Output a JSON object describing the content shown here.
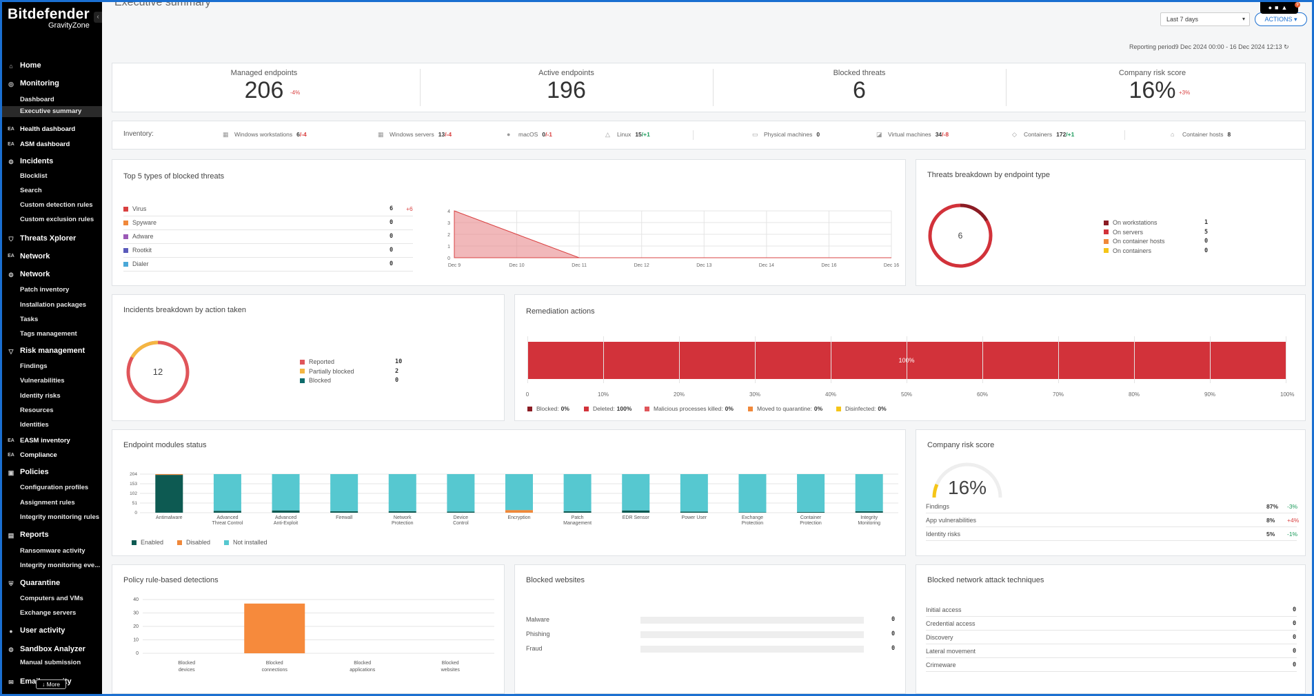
{
  "app": {
    "brand": "Bitdefender",
    "product": "GravityZone"
  },
  "page": {
    "title": "Executive summary"
  },
  "header": {
    "range": "Last 7 days",
    "actions": "ACTIONS",
    "badge": "9",
    "reporting_period": "Reporting period9 Dec 2024 00:00 - 16 Dec 2024 12:13"
  },
  "sidebar": {
    "items": [
      {
        "type": "s",
        "label": "Home",
        "icon": "⌂"
      },
      {
        "type": "s",
        "label": "Monitoring",
        "icon": "◎"
      },
      {
        "type": "i",
        "label": "Dashboard"
      },
      {
        "type": "i",
        "label": "Executive summary",
        "selected": true
      },
      {
        "type": "s",
        "label": "Health dashboard",
        "icon": "EA",
        "ea": true,
        "small": true
      },
      {
        "type": "s",
        "label": "ASM dashboard",
        "icon": "EA",
        "ea": true,
        "small": true
      },
      {
        "type": "s",
        "label": "Incidents",
        "icon": "⚙"
      },
      {
        "type": "i",
        "label": "Blocklist"
      },
      {
        "type": "i",
        "label": "Search"
      },
      {
        "type": "i",
        "label": "Custom detection rules"
      },
      {
        "type": "i",
        "label": "Custom exclusion rules"
      },
      {
        "type": "s",
        "label": "Threats Xplorer",
        "icon": "⛉"
      },
      {
        "type": "s",
        "label": "Network",
        "icon": "EA",
        "ea": true
      },
      {
        "type": "s",
        "label": "Network",
        "icon": "⚙"
      },
      {
        "type": "i",
        "label": "Patch inventory"
      },
      {
        "type": "i",
        "label": "Installation packages"
      },
      {
        "type": "i",
        "label": "Tasks"
      },
      {
        "type": "i",
        "label": "Tags management"
      },
      {
        "type": "s",
        "label": "Risk management",
        "icon": "▽"
      },
      {
        "type": "i",
        "label": "Findings"
      },
      {
        "type": "i",
        "label": "Vulnerabilities"
      },
      {
        "type": "i",
        "label": "Identity risks"
      },
      {
        "type": "i",
        "label": "Resources"
      },
      {
        "type": "i",
        "label": "Identities"
      },
      {
        "type": "s",
        "label": "EASM inventory",
        "icon": "EA",
        "ea": true,
        "small": true
      },
      {
        "type": "s",
        "label": "Compliance",
        "icon": "EA",
        "ea": true,
        "small": true
      },
      {
        "type": "s",
        "label": "Policies",
        "icon": "▣"
      },
      {
        "type": "i",
        "label": "Configuration profiles"
      },
      {
        "type": "i",
        "label": "Assignment rules"
      },
      {
        "type": "i",
        "label": "Integrity monitoring rules"
      },
      {
        "type": "s",
        "label": "Reports",
        "icon": "▤"
      },
      {
        "type": "i",
        "label": "Ransomware activity"
      },
      {
        "type": "i",
        "label": "Integrity monitoring eve..."
      },
      {
        "type": "s",
        "label": "Quarantine",
        "icon": "⛨"
      },
      {
        "type": "i",
        "label": "Computers and VMs"
      },
      {
        "type": "i",
        "label": "Exchange servers"
      },
      {
        "type": "s",
        "label": "User activity",
        "icon": "●"
      },
      {
        "type": "s",
        "label": "Sandbox Analyzer",
        "icon": "⚙"
      },
      {
        "type": "i",
        "label": "Manual submission"
      },
      {
        "type": "s",
        "label": "Email security",
        "icon": "✉"
      }
    ],
    "more": "↓ More"
  },
  "kpis": [
    {
      "label": "Managed endpoints",
      "value": "206",
      "delta": "-4%"
    },
    {
      "label": "Active endpoints",
      "value": "196",
      "delta": ""
    },
    {
      "label": "Blocked threats",
      "value": "6",
      "delta": ""
    },
    {
      "label": "Company risk score",
      "value": "16%",
      "delta": "+3%"
    }
  ],
  "inventory": {
    "label": "Inventory:",
    "items": [
      {
        "icon": "▦",
        "label": "Windows workstations",
        "value": "6",
        "delta": "/-4",
        "tone": "r"
      },
      {
        "icon": "▦",
        "label": "Windows servers",
        "value": "13",
        "delta": "/-4",
        "tone": "r"
      },
      {
        "icon": "●",
        "label": "macOS",
        "value": "0",
        "delta": "/-1",
        "tone": "r"
      },
      {
        "icon": "△",
        "label": "Linux",
        "value": "15",
        "delta": "/+1",
        "tone": "g"
      },
      {
        "icon": "▭",
        "label": "Physical machines",
        "value": "0",
        "delta": "",
        "tone": ""
      },
      {
        "icon": "◪",
        "label": "Virtual machines",
        "value": "34",
        "delta": "/-8",
        "tone": "r"
      },
      {
        "icon": "◇",
        "label": "Containers",
        "value": "172",
        "delta": "/+1",
        "tone": "g"
      },
      {
        "icon": "⌂",
        "label": "Container hosts",
        "value": "8",
        "delta": "",
        "tone": ""
      }
    ]
  },
  "top5": {
    "title": "Top 5 types of blocked threats",
    "items": [
      {
        "label": "Virus",
        "value": "6",
        "delta": "+6",
        "color": "#d94040"
      },
      {
        "label": "Spyware",
        "value": "0",
        "delta": "",
        "color": "#f0883a"
      },
      {
        "label": "Adware",
        "value": "0",
        "delta": "",
        "color": "#9b59b6"
      },
      {
        "label": "Rootkit",
        "value": "0",
        "delta": "",
        "color": "#5b5bbb"
      },
      {
        "label": "Dialer",
        "value": "0",
        "delta": "",
        "color": "#4aa8d8"
      }
    ]
  },
  "threats_breakdown": {
    "title": "Threats breakdown by endpoint type",
    "total": "6",
    "items": [
      {
        "label": "On workstations",
        "value": "1",
        "color": "#8b1c24"
      },
      {
        "label": "On servers",
        "value": "5",
        "color": "#d2323a"
      },
      {
        "label": "On container hosts",
        "value": "0",
        "color": "#f0883a"
      },
      {
        "label": "On containers",
        "value": "0",
        "color": "#f5c518"
      }
    ]
  },
  "incidents": {
    "title": "Incidents breakdown by action taken",
    "total": "12",
    "items": [
      {
        "label": "Reported",
        "value": "10",
        "color": "#e0555a"
      },
      {
        "label": "Partially blocked",
        "value": "2",
        "color": "#f4b642"
      },
      {
        "label": "Blocked",
        "value": "0",
        "color": "#0d6b6b"
      }
    ]
  },
  "remediation": {
    "title": "Remediation actions",
    "bar_label": "100%",
    "ticks": [
      "0",
      "10%",
      "20%",
      "30%",
      "40%",
      "50%",
      "60%",
      "70%",
      "80%",
      "90%",
      "100%"
    ],
    "legend": [
      {
        "label": "Blocked:",
        "value": "0%",
        "color": "#8b1c24"
      },
      {
        "label": "Deleted:",
        "value": "100%",
        "color": "#d2323a"
      },
      {
        "label": "Malicious processes killed:",
        "value": "0%",
        "color": "#e0555a"
      },
      {
        "label": "Moved to quarantine:",
        "value": "0%",
        "color": "#f0883a"
      },
      {
        "label": "Disinfected:",
        "value": "0%",
        "color": "#f5c518"
      }
    ]
  },
  "modules": {
    "title": "Endpoint modules status",
    "legend": [
      {
        "label": "Enabled",
        "color": "#0d5a52"
      },
      {
        "label": "Disabled",
        "color": "#f0883a"
      },
      {
        "label": "Not installed",
        "color": "#56c8d0"
      }
    ]
  },
  "risk": {
    "title": "Company risk score",
    "value": "16%",
    "rows": [
      {
        "label": "Findings",
        "value": "87%",
        "delta": "-3%",
        "tone": "g"
      },
      {
        "label": "App vulnerabilities",
        "value": "8%",
        "delta": "+4%",
        "tone": "r"
      },
      {
        "label": "Identity risks",
        "value": "5%",
        "delta": "-1%",
        "tone": "g"
      }
    ]
  },
  "policy": {
    "title": "Policy rule-based detections"
  },
  "blocked_websites": {
    "title": "Blocked websites",
    "rows": [
      {
        "label": "Malware",
        "value": "0"
      },
      {
        "label": "Phishing",
        "value": "0"
      },
      {
        "label": "Fraud",
        "value": "0"
      }
    ]
  },
  "network_attacks": {
    "title": "Blocked network attack techniques",
    "rows": [
      {
        "label": "Initial access",
        "value": "0"
      },
      {
        "label": "Credential access",
        "value": "0"
      },
      {
        "label": "Discovery",
        "value": "0"
      },
      {
        "label": "Lateral movement",
        "value": "0"
      },
      {
        "label": "Crimeware",
        "value": "0"
      }
    ]
  },
  "chart_data": [
    {
      "type": "area",
      "title": "Top 5 types of blocked threats",
      "x": [
        "Dec 9",
        "Dec 10",
        "Dec 11",
        "Dec 12",
        "Dec 13",
        "Dec 14",
        "Dec 16",
        "Dec 16"
      ],
      "series": [
        {
          "name": "Virus",
          "values": [
            4,
            2,
            0,
            0,
            0,
            0,
            0,
            0
          ]
        }
      ],
      "yticks": [
        "0",
        "1",
        "2",
        "3",
        "4"
      ],
      "ylim": [
        0,
        4
      ],
      "color": "#e8888c"
    },
    {
      "type": "bar",
      "title": "Endpoint modules status",
      "stacked": true,
      "categories": [
        "Antimalware",
        "Advanced Threat Control",
        "Advanced Anti-Exploit",
        "Firewall",
        "Network Protection",
        "Device Control",
        "Encryption",
        "Patch Management",
        "EDR Sensor",
        "Power User",
        "Exchange Protection",
        "Container Protection",
        "Integrity Monitoring"
      ],
      "series": [
        {
          "name": "Enabled",
          "values": [
            200,
            10,
            12,
            8,
            8,
            6,
            0,
            8,
            12,
            6,
            2,
            4,
            8
          ]
        },
        {
          "name": "Disabled",
          "values": [
            4,
            0,
            0,
            0,
            0,
            0,
            14,
            0,
            0,
            0,
            0,
            0,
            0
          ]
        },
        {
          "name": "Not installed",
          "values": [
            0,
            194,
            192,
            196,
            196,
            198,
            190,
            196,
            192,
            198,
            202,
            200,
            196
          ]
        }
      ],
      "yticks": [
        "0",
        "51",
        "102",
        "153",
        "204"
      ],
      "ylim": [
        0,
        204
      ]
    },
    {
      "type": "bar",
      "title": "Policy rule-based detections",
      "categories": [
        "Blocked devices",
        "Blocked connections",
        "Blocked applications",
        "Blocked websites"
      ],
      "values": [
        0,
        37,
        0,
        0
      ],
      "yticks": [
        "0",
        "10",
        "20",
        "30",
        "40"
      ],
      "ylim": [
        0,
        40
      ],
      "color": "#f68a3c"
    }
  ]
}
